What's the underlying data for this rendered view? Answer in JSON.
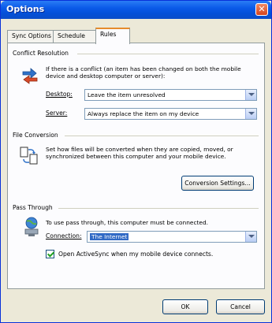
{
  "window": {
    "title": "Options",
    "close_glyph": "✕"
  },
  "tabs": [
    {
      "label": "Sync Options",
      "active": false
    },
    {
      "label": "Schedule",
      "active": false
    },
    {
      "label": "Rules",
      "active": true
    }
  ],
  "conflict": {
    "group_label": "Conflict Resolution",
    "description": "If there is a conflict (an item has been changed on both the mobile device and desktop computer or server):",
    "desktop_label": "Desktop:",
    "desktop_value": "Leave the item unresolved",
    "server_label": "Server:",
    "server_value": "Always replace the item on my device",
    "icon": "sync-arrows-icon"
  },
  "conversion": {
    "group_label": "File Conversion",
    "description": "Set how files will be converted when they are copied, moved, or synchronized between this computer and your mobile device.",
    "button_label": "Conversion Settings...",
    "icon": "file-conversion-icon"
  },
  "pass_through": {
    "group_label": "Pass Through",
    "description": "To use pass through, this computer must be connected.",
    "connection_label": "Connection:",
    "connection_value": "The Internet",
    "checkbox_label": "Open ActiveSync when my mobile device connects.",
    "checkbox_checked": true,
    "icon": "network-globe-icon"
  },
  "footer": {
    "ok_label": "OK",
    "cancel_label": "Cancel"
  }
}
